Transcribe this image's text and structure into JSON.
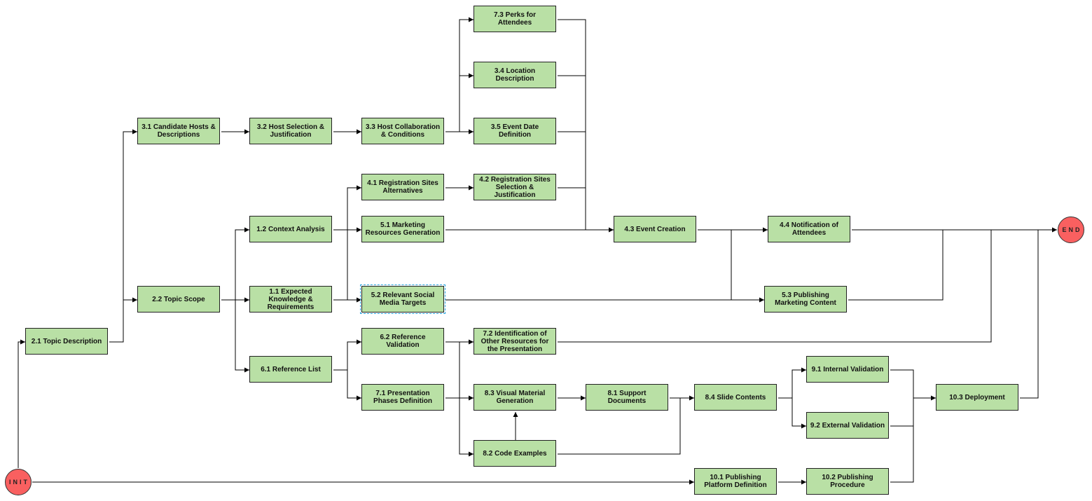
{
  "start": {
    "label": "INIT"
  },
  "end": {
    "label": "END"
  },
  "colors": {
    "task": "#b9e0a5",
    "terminal": "#f96060",
    "line": "#000000",
    "selection": "#29a6e0"
  },
  "nodes": [
    {
      "id": "2.1",
      "label": "2.1 Topic Description"
    },
    {
      "id": "3.1",
      "label": "3.1 Candidate Hosts & Descriptions"
    },
    {
      "id": "2.2",
      "label": "2.2 Topic Scope"
    },
    {
      "id": "3.2",
      "label": "3.2 Host Selection & Justification"
    },
    {
      "id": "1.2",
      "label": "1.2 Context Analysis"
    },
    {
      "id": "1.1",
      "label": "1.1 Expected Knowledge & Requirements"
    },
    {
      "id": "6.1",
      "label": "6.1 Reference List"
    },
    {
      "id": "3.3",
      "label": "3.3 Host Collaboration & Conditions"
    },
    {
      "id": "4.1",
      "label": "4.1 Registration Sites Alternatives"
    },
    {
      "id": "5.1",
      "label": "5.1 Marketing Resources Generation"
    },
    {
      "id": "5.2",
      "label": "5.2 Relevant Social Media Targets",
      "selected": true
    },
    {
      "id": "6.2",
      "label": "6.2 Reference Validation"
    },
    {
      "id": "7.1",
      "label": "7.1 Presentation Phases Definition"
    },
    {
      "id": "7.3",
      "label": "7.3 Perks for Attendees"
    },
    {
      "id": "3.4",
      "label": "3.4 Location Description"
    },
    {
      "id": "3.5",
      "label": "3.5 Event Date Definition"
    },
    {
      "id": "4.2",
      "label": "4.2 Registration Sites Selection & Justification"
    },
    {
      "id": "7.2",
      "label": "7.2 Identification of Other Resources for the Presentation"
    },
    {
      "id": "8.3",
      "label": "8.3 Visual Material Generation"
    },
    {
      "id": "8.2",
      "label": "8.2 Code Examples"
    },
    {
      "id": "8.1",
      "label": "8.1 Support Documents"
    },
    {
      "id": "4.3",
      "label": "4.3 Event Creation"
    },
    {
      "id": "8.4",
      "label": "8.4 Slide Contents"
    },
    {
      "id": "10.1",
      "label": "10.1 Publishing Platform Definition"
    },
    {
      "id": "4.4",
      "label": "4.4 Notification of Attendees"
    },
    {
      "id": "5.3",
      "label": "5.3 Publishing Marketing Content"
    },
    {
      "id": "9.1",
      "label": "9.1 Internal Validation"
    },
    {
      "id": "9.2",
      "label": "9.2 External Validation"
    },
    {
      "id": "10.2",
      "label": "10.2 Publishing Procedure"
    },
    {
      "id": "10.3",
      "label": "10.3 Deployment"
    }
  ]
}
